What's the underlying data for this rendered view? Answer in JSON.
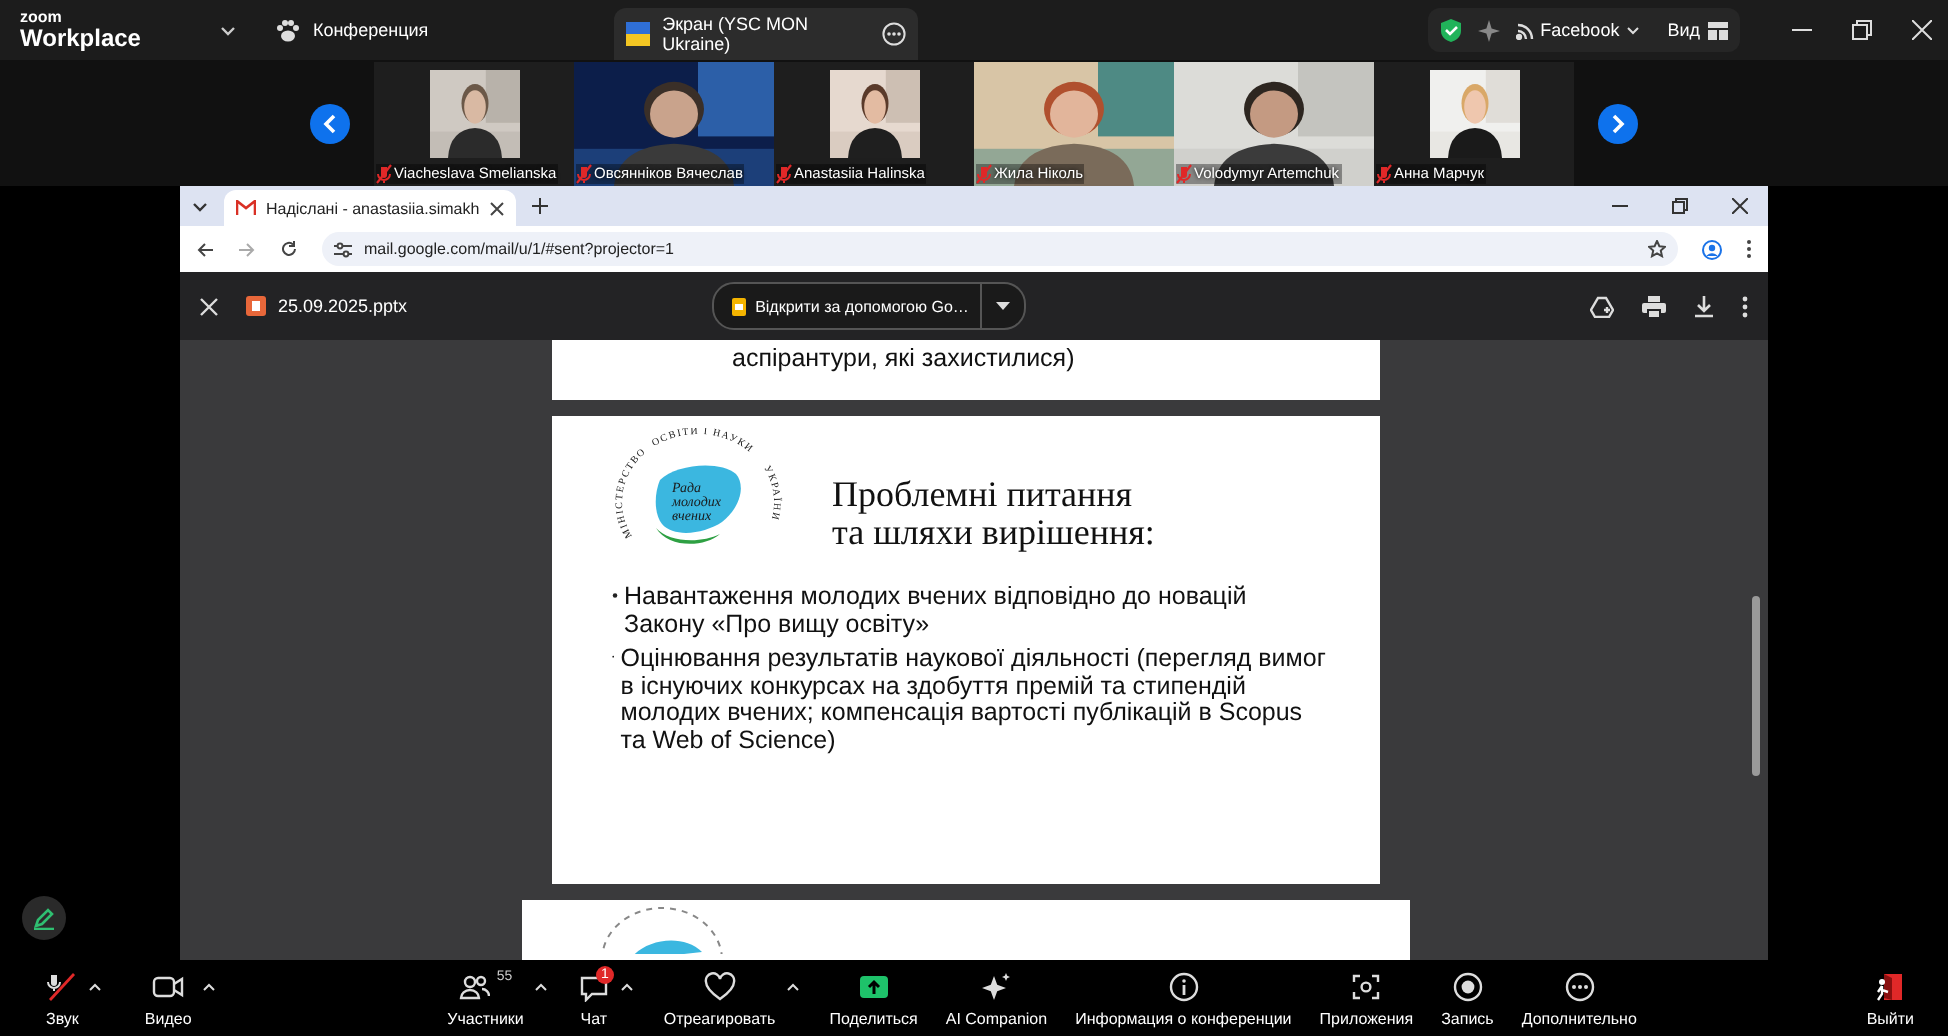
{
  "top_bar": {
    "logo": [
      "zoom",
      "Workplace"
    ],
    "meeting_menu": "Конференция",
    "share_tab": "Экран (YSC MON Ukraine)",
    "account": "Facebook",
    "view_button": "Вид"
  },
  "participants": [
    {
      "name": "Viacheslava Smelianska",
      "muted": true
    },
    {
      "name": "Овсянніков Вячеслав",
      "muted": true
    },
    {
      "name": "Anastasiia Halinska",
      "muted": true
    },
    {
      "name": "Жила Ніколь",
      "muted": true
    },
    {
      "name": "Volodymyr Artemchuk",
      "muted": true
    },
    {
      "name": "Анна Марчук",
      "muted": true
    }
  ],
  "browser": {
    "tab_title": "Надіслані - anastasiia.simakh",
    "url": "mail.google.com/mail/u/1/#sent?projector=1"
  },
  "viewer": {
    "file_name": "25.09.2025.pptx",
    "open_with": "Відкрити за допомогою Go…"
  },
  "slides": [
    {
      "kind": "partial_top",
      "lines": [
        "аспірантури, які захистилися)"
      ]
    },
    {
      "kind": "full",
      "logo_name": [
        "Рада",
        "молодих",
        "вчених"
      ],
      "logo_ring": [
        "МІНІСТЕРСТВО",
        "ОСВІТИ І НАУКИ",
        "УКРАЇНИ"
      ],
      "title": [
        "Проблемні питання",
        "та шляхи вирішення:"
      ],
      "bullets": [
        "Навантаження молодих вчених відповідно до новацій Закону «Про вищу освіту»",
        "Оцінювання результатів наукової діяльності (перегляд вимог в існуючих конкурсах на здобуття премій та стипендій молодих вчених; компенсація вартості публікацій в Scopus та Web of Science)"
      ]
    },
    {
      "kind": "partial_bottom"
    }
  ],
  "toolbar": [
    {
      "kind": "mic",
      "label": "Звук",
      "muted": true,
      "caret": true
    },
    {
      "kind": "video",
      "label": "Видео",
      "muted": false,
      "caret": true
    },
    {
      "kind": "participants",
      "label": "Участники",
      "count": "55",
      "muted": false,
      "caret": true
    },
    {
      "kind": "chat",
      "label": "Чат",
      "badge": "1",
      "muted": false,
      "caret": true
    },
    {
      "kind": "react",
      "label": "Отреагировать",
      "muted": false,
      "caret": true
    },
    {
      "kind": "share",
      "label": "Поделиться",
      "muted": false,
      "caret": false
    },
    {
      "kind": "ai",
      "label": "AI Companion",
      "muted": false,
      "caret": false
    },
    {
      "kind": "info",
      "label": "Информация о конференции",
      "muted": false,
      "caret": false
    },
    {
      "kind": "apps",
      "label": "Приложения",
      "muted": false,
      "caret": false
    },
    {
      "kind": "record",
      "label": "Запись",
      "muted": false,
      "caret": false
    },
    {
      "kind": "more",
      "label": "Дополнительно",
      "muted": false,
      "caret": false
    },
    {
      "kind": "leave",
      "label": "Выйти",
      "muted": false,
      "caret": false
    }
  ]
}
